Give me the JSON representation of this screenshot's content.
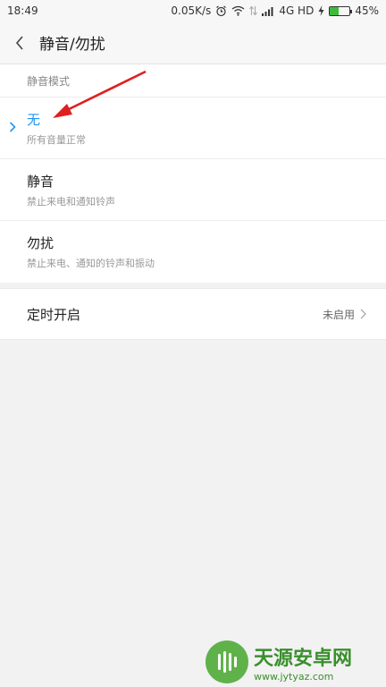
{
  "status_bar": {
    "time": "18:49",
    "speed": "0.05K/s",
    "network": "4G HD",
    "battery": "45%",
    "battery_level": 0.45
  },
  "header": {
    "title": "静音/勿扰"
  },
  "modes": {
    "section_label": "静音模式",
    "items": [
      {
        "title": "无",
        "subtitle": "所有音量正常",
        "selected": true
      },
      {
        "title": "静音",
        "subtitle": "禁止来电和通知铃声",
        "selected": false
      },
      {
        "title": "勿扰",
        "subtitle": "禁止来电、通知的铃声和振动",
        "selected": false
      }
    ]
  },
  "schedule": {
    "label": "定时开启",
    "value": "未启用"
  },
  "watermark": {
    "name": "天源安卓网",
    "url": "www.jytyaz.com"
  },
  "colors": {
    "accent": "#2196f3",
    "annotation": "#e02020"
  }
}
